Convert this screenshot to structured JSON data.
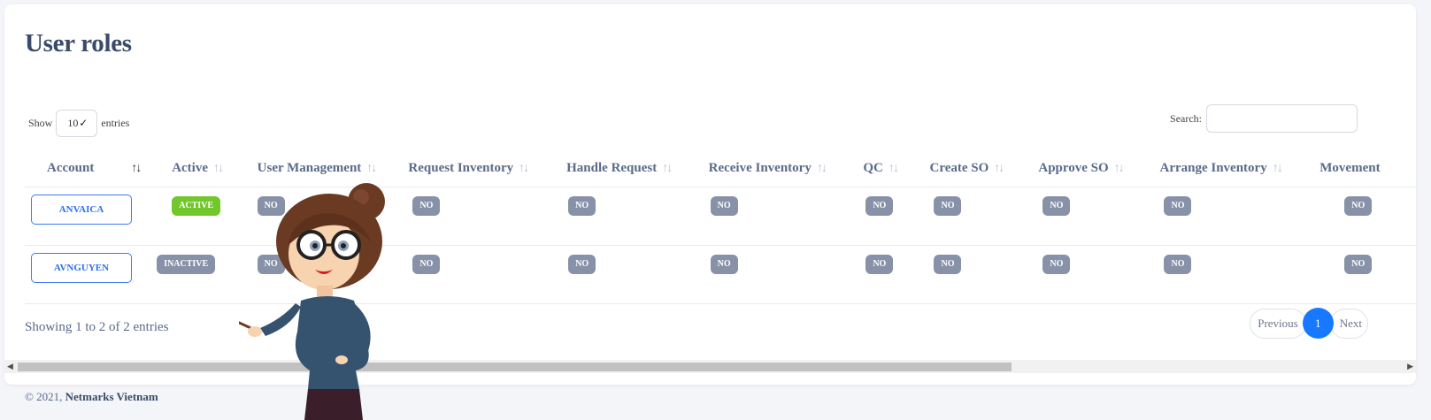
{
  "page": {
    "title": "User roles"
  },
  "controls": {
    "show_label": "Show",
    "entries_value": "10",
    "entries_label": "entries",
    "search_label": "Search:"
  },
  "table": {
    "columns": [
      "Account",
      "Active",
      "User Management",
      "Request Inventory",
      "Handle Request",
      "Receive Inventory",
      "QC",
      "Create SO",
      "Approve SO",
      "Arrange Inventory",
      "Movement"
    ],
    "rows": [
      {
        "account": "ANVAICA",
        "active": "ACTIVE",
        "perms": [
          "NO",
          "NO",
          "NO",
          "NO",
          "NO",
          "NO",
          "NO",
          "NO",
          "NO"
        ]
      },
      {
        "account": "AVNGUYEN",
        "active": "INACTIVE",
        "perms": [
          "NO",
          "NO",
          "NO",
          "NO",
          "NO",
          "NO",
          "NO",
          "NO",
          "NO"
        ]
      }
    ]
  },
  "info": {
    "showing": "Showing 1 to 2 of 2 entries"
  },
  "pagination": {
    "previous": "Previous",
    "current": "1",
    "next": "Next"
  },
  "footer": {
    "copyright": "© 2021,",
    "company": "Netmarks Vietnam"
  },
  "colors": {
    "accent": "#1779ff",
    "active_badge": "#72c72a",
    "no_badge": "#8792a8",
    "title": "#3a4b6a"
  }
}
